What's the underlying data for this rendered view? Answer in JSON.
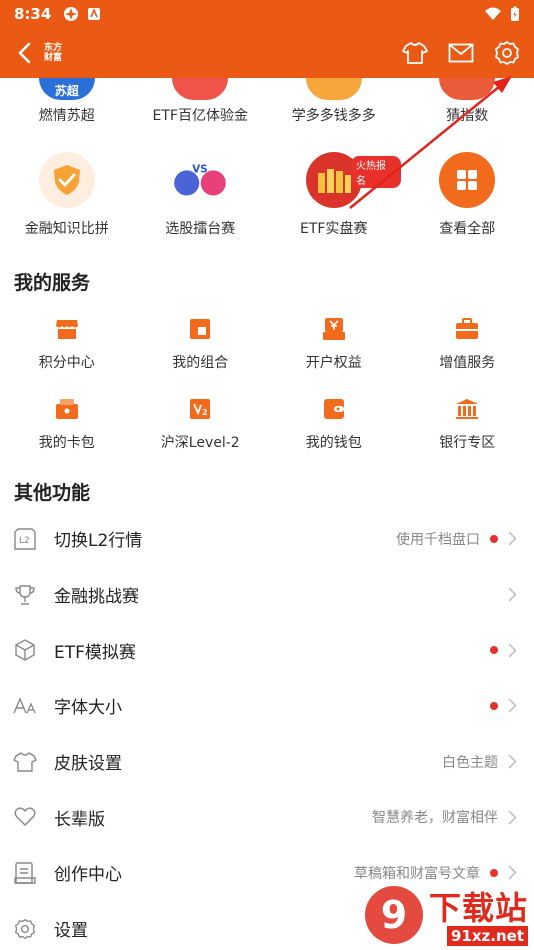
{
  "status": {
    "time": "8:34"
  },
  "header": {
    "logo_line1": "东方",
    "logo_line2": "财富"
  },
  "top_grid": {
    "row1": [
      {
        "label": "燃情苏超",
        "icon_text": "苏超"
      },
      {
        "label": "ETF百亿体验金"
      },
      {
        "label": "学多多钱多多"
      },
      {
        "label": "猜指数"
      }
    ],
    "row2": [
      {
        "label": "金融知识比拼"
      },
      {
        "label": "选股擂台赛",
        "icon_text": "VS"
      },
      {
        "label": "ETF实盘赛",
        "badge": "火热报名"
      },
      {
        "label": "查看全部"
      }
    ]
  },
  "services": {
    "title": "我的服务",
    "items": [
      {
        "label": "积分中心",
        "icon": "store-icon"
      },
      {
        "label": "我的组合",
        "icon": "portfolio-icon"
      },
      {
        "label": "开户权益",
        "icon": "yen-icon"
      },
      {
        "label": "增值服务",
        "icon": "briefcase-icon"
      },
      {
        "label": "我的卡包",
        "icon": "card-wallet-icon"
      },
      {
        "label": "沪深Level-2",
        "icon": "level2-icon"
      },
      {
        "label": "我的钱包",
        "icon": "wallet-icon"
      },
      {
        "label": "银行专区",
        "icon": "bank-icon"
      }
    ]
  },
  "functions": {
    "title": "其他功能",
    "items": [
      {
        "label": "切换L2行情",
        "sub": "使用千档盘口",
        "dot": true,
        "icon": "l2-icon"
      },
      {
        "label": "金融挑战赛",
        "sub": "",
        "dot": false,
        "icon": "trophy-icon"
      },
      {
        "label": "ETF模拟赛",
        "sub": "",
        "dot": true,
        "icon": "cube-icon"
      },
      {
        "label": "字体大小",
        "sub": "",
        "dot": true,
        "icon": "font-size-icon"
      },
      {
        "label": "皮肤设置",
        "sub": "白色主题",
        "dot": false,
        "icon": "shirt-icon"
      },
      {
        "label": "长辈版",
        "sub": "智慧养老，财富相伴",
        "dot": false,
        "icon": "heart-icon"
      },
      {
        "label": "创作中心",
        "sub": "草稿箱和财富号文章",
        "dot": true,
        "icon": "compose-icon"
      },
      {
        "label": "设置",
        "sub": "",
        "dot": false,
        "icon": "gear-icon"
      }
    ]
  },
  "watermark": {
    "main": "下载站",
    "sub": "91xz.net",
    "logo_text": "9"
  },
  "colors": {
    "brand": "#eb5a14",
    "accent_red": "#e8312a",
    "icon_orange": "#f26a1b"
  }
}
